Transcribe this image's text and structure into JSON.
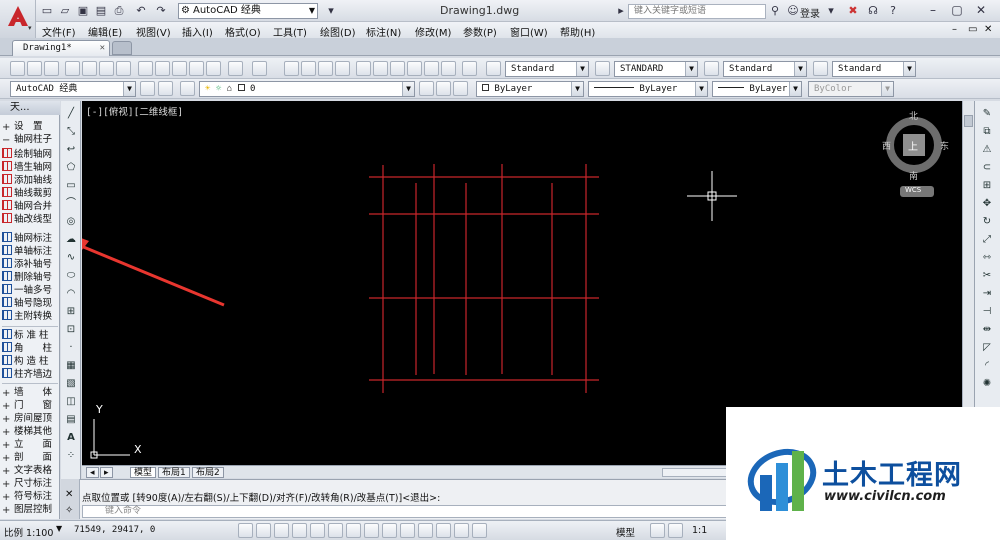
{
  "app": {
    "workspace": "AutoCAD 经典",
    "doc_title": "Drawing1.dwg",
    "search_placeholder": "键入关键字或短语",
    "login": "登录",
    "tab": "Drawing1*"
  },
  "menus": [
    "文件(F)",
    "编辑(E)",
    "视图(V)",
    "插入(I)",
    "格式(O)",
    "工具(T)",
    "绘图(D)",
    "标注(N)",
    "修改(M)",
    "参数(P)",
    "窗口(W)",
    "帮助(H)"
  ],
  "toolbar1": {
    "text_style": "Standard",
    "dim_style": "STANDARD",
    "table_style": "Standard",
    "mleader_style": "Standard"
  },
  "toolbar2": {
    "workspace": "AutoCAD 经典",
    "layer": "0",
    "color": "ByLayer",
    "linetype": "ByLayer",
    "lineweight": "ByLayer",
    "plotstyle": "ByColor"
  },
  "palette": {
    "title": "天...",
    "items": [
      {
        "label": "设　置",
        "icon": "plus-icon"
      },
      {
        "label": "轴网柱子",
        "icon": "minus-icon"
      },
      {
        "label": "绘制轴网",
        "icon": "grid-icon"
      },
      {
        "label": "墙生轴网",
        "icon": "grid-icon"
      },
      {
        "label": "添加轴线",
        "icon": "grid-icon"
      },
      {
        "label": "轴线裁剪",
        "icon": "grid-icon"
      },
      {
        "label": "轴网合并",
        "icon": "grid-icon"
      },
      {
        "label": "轴改线型",
        "icon": "grid-icon"
      },
      {
        "label": "轴网标注",
        "icon": "axis-dim-icon"
      },
      {
        "label": "单轴标注",
        "icon": "axis-dim-icon"
      },
      {
        "label": "添补轴号",
        "icon": "axis-num-icon"
      },
      {
        "label": "删除轴号",
        "icon": "axis-num-icon"
      },
      {
        "label": "一轴多号",
        "icon": "axis-num-icon"
      },
      {
        "label": "轴号隐现",
        "icon": "axis-num-icon"
      },
      {
        "label": "主附转换",
        "icon": "axis-num-icon"
      },
      {
        "label": "标 准 柱",
        "icon": "column-icon"
      },
      {
        "label": "角　　柱",
        "icon": "column-icon"
      },
      {
        "label": "构 造 柱",
        "icon": "column-icon"
      },
      {
        "label": "柱齐墙边",
        "icon": "column-icon"
      },
      {
        "label": "墙　　体",
        "icon": "plus-icon"
      },
      {
        "label": "门　　窗",
        "icon": "plus-icon"
      },
      {
        "label": "房间屋顶",
        "icon": "plus-icon"
      },
      {
        "label": "楼梯其他",
        "icon": "plus-icon"
      },
      {
        "label": "立　　面",
        "icon": "plus-icon"
      },
      {
        "label": "剖　　面",
        "icon": "plus-icon"
      },
      {
        "label": "文字表格",
        "icon": "plus-icon"
      },
      {
        "label": "尺寸标注",
        "icon": "plus-icon"
      },
      {
        "label": "符号标注",
        "icon": "plus-icon"
      },
      {
        "label": "图层控制",
        "icon": "plus-icon"
      }
    ]
  },
  "canvas": {
    "view_label": "[-][俯视][二维线框]",
    "compass": {
      "north": "北",
      "south": "南",
      "east": "东",
      "west": "西",
      "top": "上",
      "wcs": "WCS"
    },
    "ucs_x": "X",
    "ucs_y": "Y"
  },
  "layout_tabs": [
    "模型",
    "布局1",
    "布局2"
  ],
  "command": {
    "prompt": "点取位置或 [转90度(A)/左右翻(S)/上下翻(D)/对齐(F)/改转角(R)/改基点(T)]<退出>:",
    "input_placeholder": "键入命令"
  },
  "status": {
    "scale": "比例 1:100",
    "coords": "71549, 29417, 0",
    "model": "模型",
    "anno_scale": "1:1"
  },
  "watermark": {
    "name": "土木工程网",
    "url": "www.civilcn.com"
  },
  "colors": {
    "grid_line": "#c8262b",
    "arrow": "#e8362f"
  }
}
